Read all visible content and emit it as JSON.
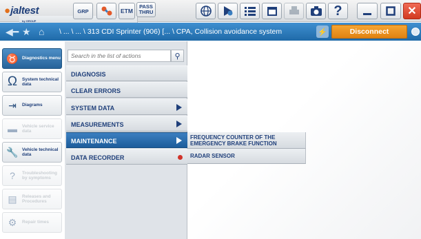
{
  "toolbar": {
    "logo": "jaltest",
    "logo_sub": "by GROUP",
    "grp_label": "GRP",
    "etm_label": "ETM",
    "pass_label": "PASS\nTHRU",
    "icons": [
      "globe-icon",
      "vehicle-icon",
      "list-icon",
      "calendar-icon",
      "print-icon",
      "camera-icon",
      "help-icon",
      "minimize-icon",
      "maximize-icon",
      "close-icon"
    ],
    "help_label": "?"
  },
  "navbar": {
    "breadcrumb": "\\ ... \\ ... \\ 313 CDI Sprinter (906) [... \\ CPA, Collision avoidance system",
    "disconnect_label": "Disconnect",
    "accent": "#2b78bb",
    "disconnect_color": "#f0951f"
  },
  "sidebar": {
    "items": [
      {
        "label": "Diagnostics menu",
        "icon": "diagnostics-icon"
      },
      {
        "label": "System technical data",
        "icon": "omega-icon"
      },
      {
        "label": "Diagrams",
        "icon": "diagram-icon"
      },
      {
        "label": "Vehicle service data",
        "icon": "service-icon"
      },
      {
        "label": "Vehicle technical data",
        "icon": "wrench-icon"
      },
      {
        "label": "Troubleshooting by symptoms",
        "icon": "troubleshooting-icon"
      },
      {
        "label": "Releases and Procedures",
        "icon": "releases-icon"
      },
      {
        "label": "Repair times",
        "icon": "repair-icon"
      }
    ]
  },
  "actions": {
    "search_placeholder": "Search in the list of actions",
    "items": [
      {
        "label": "DIAGNOSIS"
      },
      {
        "label": "CLEAR ERRORS"
      },
      {
        "label": "SYSTEM DATA"
      },
      {
        "label": "MEASUREMENTS"
      },
      {
        "label": "MAINTENANCE"
      },
      {
        "label": "DATA RECORDER"
      }
    ]
  },
  "submenu": {
    "items": [
      {
        "label": "FREQUENCY COUNTER OF THE EMERGENCY BRAKE FUNCTION"
      },
      {
        "label": "RADAR SENSOR"
      }
    ]
  }
}
